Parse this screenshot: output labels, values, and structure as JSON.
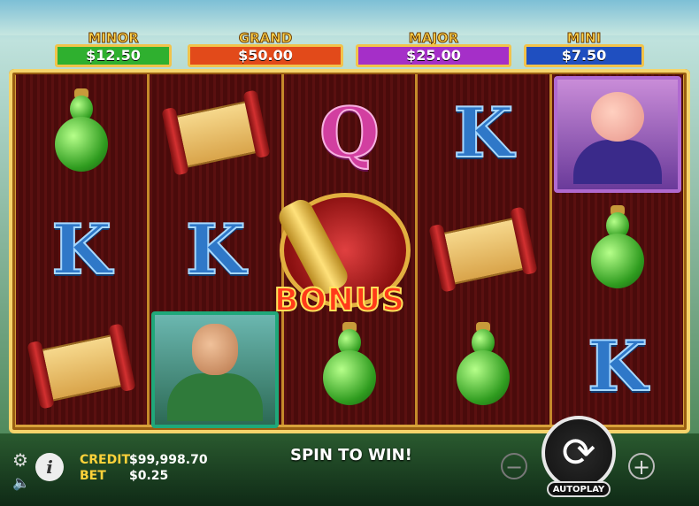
{
  "jackpots": [
    {
      "name": "MINOR",
      "value": "$12.50",
      "color": "#2fb02f"
    },
    {
      "name": "GRAND",
      "value": "$50.00",
      "color": "#e24a1a"
    },
    {
      "name": "MAJOR",
      "value": "$25.00",
      "color": "#a52fc8"
    },
    {
      "name": "MINI",
      "value": "$7.50",
      "color": "#1f4fc0"
    }
  ],
  "reels": {
    "symbols": [
      [
        "gourd",
        "K",
        "scroll"
      ],
      [
        "scroll",
        "K",
        "warrior"
      ],
      [
        "Q",
        "bonus",
        "gourd"
      ],
      [
        "K",
        "scroll",
        "gourd"
      ],
      [
        "pig",
        "gourd",
        "K"
      ]
    ],
    "bonus_label": "BONUS",
    "letters": {
      "K": "K",
      "Q": "Q"
    }
  },
  "status": {
    "credit_label": "CREDIT",
    "credit_value": "$99,998.70",
    "bet_label": "BET",
    "bet_value": "$0.25",
    "message": "SPIN TO WIN!"
  },
  "controls": {
    "autoplay_label": "AUTOPLAY",
    "minus_symbol": "−",
    "plus_symbol": "+",
    "info_symbol": "i",
    "spin_symbol": "⟳",
    "gear_symbol": "⚙",
    "speaker_symbol": "🔈"
  }
}
